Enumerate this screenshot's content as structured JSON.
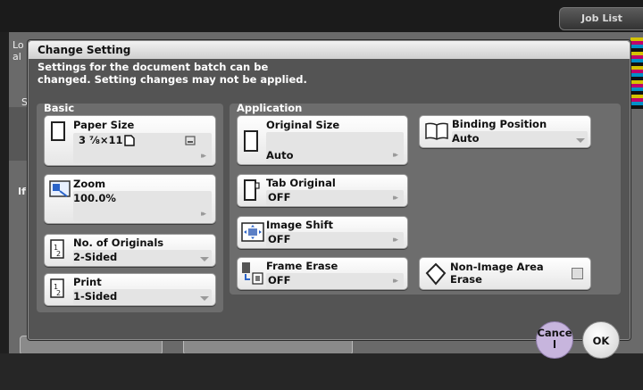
{
  "background": {
    "job_list": "Job List",
    "left_text": "Lo al",
    "left_letter": "S",
    "left_if": "If T"
  },
  "dialog": {
    "title": "Change Setting",
    "message_line1": "Settings for the document batch can be",
    "message_line2": "changed. Setting changes may not be applied."
  },
  "basic": {
    "label": "Basic",
    "paper_size": {
      "label": "Paper Size",
      "value": "3 ⅞×11"
    },
    "zoom": {
      "label": "Zoom",
      "value": "100.0%"
    },
    "originals": {
      "label": "No. of Originals",
      "value": "2-Sided"
    },
    "print": {
      "label": "Print",
      "value": "1-Sided"
    }
  },
  "application": {
    "label": "Application",
    "original_size": {
      "label": "Original Size",
      "value": "Auto"
    },
    "tab_original": {
      "label": "Tab Original",
      "value": "OFF"
    },
    "image_shift": {
      "label": "Image Shift",
      "value": "OFF"
    },
    "frame_erase": {
      "label": "Frame Erase",
      "value": "OFF"
    },
    "binding_position": {
      "label": "Binding Position",
      "value": "Auto"
    },
    "non_image_erase": {
      "label1": "Non-Image Area",
      "label2": "Erase"
    }
  },
  "actions": {
    "cancel_line1": "Cance",
    "cancel_line2": "l",
    "ok": "OK"
  },
  "colors": {
    "cancel_bg": "#c7b5dd",
    "ok_bg": "#e2e2e2",
    "dialog_bg": "#545454"
  }
}
